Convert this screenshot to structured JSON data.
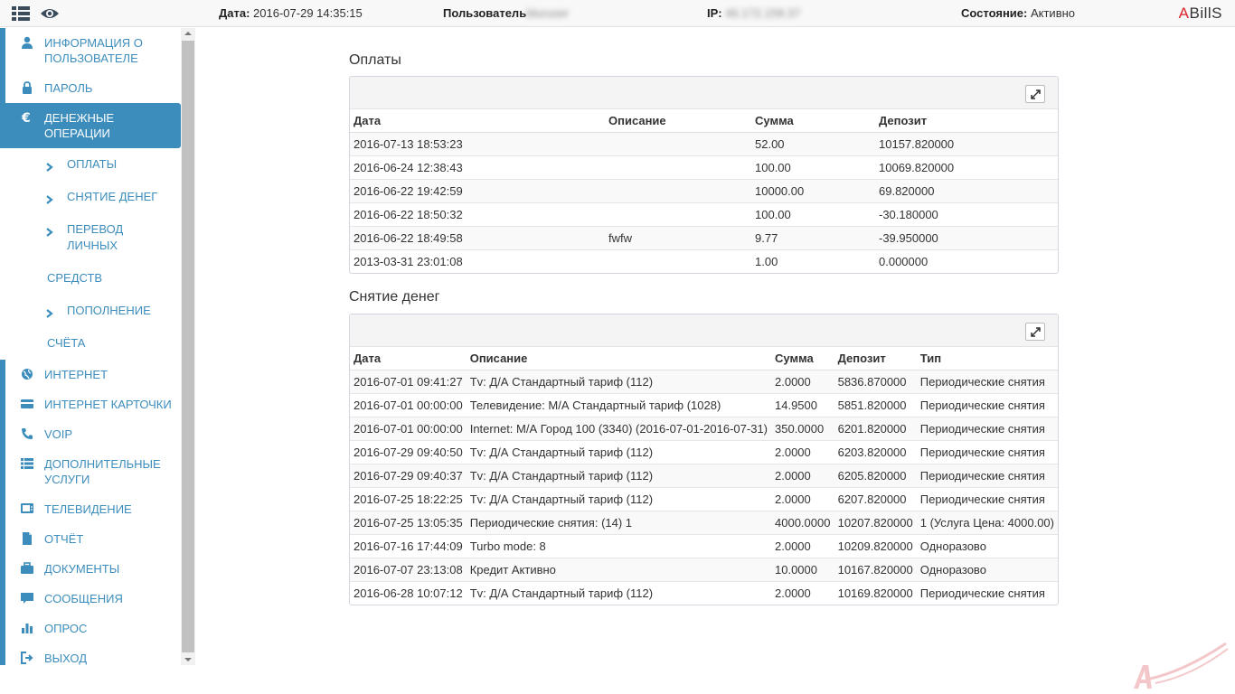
{
  "topbar": {
    "date_label": "Дата:",
    "date_value": "2016-07-29 14:35:15",
    "user_label": "Пользователь",
    "user_value": "bluruser",
    "ip_label": "IP:",
    "ip_value": "46.172.158.37",
    "status_label": "Состояние:",
    "status_value": "Активно",
    "brand_a": "A",
    "brand_rest": "BillS",
    "icons": [
      "list-icon",
      "eye-icon"
    ]
  },
  "sidebar": {
    "items": [
      {
        "label": "Информация о пользователе",
        "icon": "user-icon"
      },
      {
        "label": "Пароль",
        "icon": "lock-icon"
      },
      {
        "label": "Денежные операции",
        "icon": "euro-icon"
      },
      {
        "label": "Интернет",
        "icon": "globe-icon"
      },
      {
        "label": "Интернет карточки",
        "icon": "card-icon"
      },
      {
        "label": "VoIP",
        "icon": "phone-icon"
      },
      {
        "label": "Дополнительные услуги",
        "icon": "list-icon"
      },
      {
        "label": "Телевидение",
        "icon": "tv-icon"
      },
      {
        "label": "Отчёт",
        "icon": "file-icon"
      },
      {
        "label": "Документы",
        "icon": "briefcase-icon"
      },
      {
        "label": "Сообщения",
        "icon": "comment-icon"
      },
      {
        "label": "Опрос",
        "icon": "bar-chart-icon"
      },
      {
        "label": "Выход",
        "icon": "logout-icon"
      }
    ],
    "sub_items": [
      {
        "label": "Оплаты",
        "cont": ""
      },
      {
        "label": "Снятие денег",
        "cont": ""
      },
      {
        "label": "Перевод личных",
        "cont": "средств"
      },
      {
        "label": "Пополнение",
        "cont": "счёта"
      }
    ]
  },
  "payments": {
    "title": "Оплаты",
    "columns": [
      "Дата",
      "Описание",
      "Сумма",
      "Депозит"
    ],
    "rows": [
      [
        "2016-07-13 18:53:23",
        "",
        "52.00",
        "10157.820000"
      ],
      [
        "2016-06-24 12:38:43",
        "",
        "100.00",
        "10069.820000"
      ],
      [
        "2016-06-22 19:42:59",
        "",
        "10000.00",
        "69.820000"
      ],
      [
        "2016-06-22 18:50:32",
        "",
        "100.00",
        "-30.180000"
      ],
      [
        "2016-06-22 18:49:58",
        "fwfw",
        "9.77",
        "-39.950000"
      ],
      [
        "2013-03-31 23:01:08",
        "",
        "1.00",
        "0.000000"
      ]
    ]
  },
  "withdrawals": {
    "title": "Снятие денег",
    "columns": [
      "Дата",
      "Описание",
      "Сумма",
      "Депозит",
      "Тип"
    ],
    "rows": [
      [
        "2016-07-01 09:41:27",
        "Tv: Д/А Стандартный тариф (112)",
        "2.0000",
        "5836.870000",
        "Периодические снятия"
      ],
      [
        "2016-07-01 00:00:00",
        "Телевидение: М/А Стандартный тариф (1028)",
        "14.9500",
        "5851.820000",
        "Периодические снятия"
      ],
      [
        "2016-07-01 00:00:00",
        "Internet: М/А Город 100 (3340) (2016-07-01-2016-07-31)",
        "350.0000",
        "6201.820000",
        "Периодические снятия"
      ],
      [
        "2016-07-29 09:40:50",
        "Tv: Д/А Стандартный тариф (112)",
        "2.0000",
        "6203.820000",
        "Периодические снятия"
      ],
      [
        "2016-07-29 09:40:37",
        "Tv: Д/А Стандартный тариф (112)",
        "2.0000",
        "6205.820000",
        "Периодические снятия"
      ],
      [
        "2016-07-25 18:22:25",
        "Tv: Д/А Стандартный тариф (112)",
        "2.0000",
        "6207.820000",
        "Периодические снятия"
      ],
      [
        "2016-07-25 13:05:35",
        "Периодические снятия: (14) 1",
        "4000.0000",
        "10207.820000",
        "1 (Услуга Цена: 4000.00)"
      ],
      [
        "2016-07-16 17:44:09",
        "Turbo mode: 8",
        "2.0000",
        "10209.820000",
        "Одноразово"
      ],
      [
        "2016-07-07 23:13:08",
        "Кредит Активно",
        "10.0000",
        "10167.820000",
        "Одноразово"
      ],
      [
        "2016-06-28 10:07:12",
        "Tv: Д/А Стандартный тариф (112)",
        "2.0000",
        "10169.820000",
        "Периодические снятия"
      ]
    ]
  },
  "colors": {
    "accent": "#3c8dbc",
    "brand_red": "#d9262c"
  }
}
